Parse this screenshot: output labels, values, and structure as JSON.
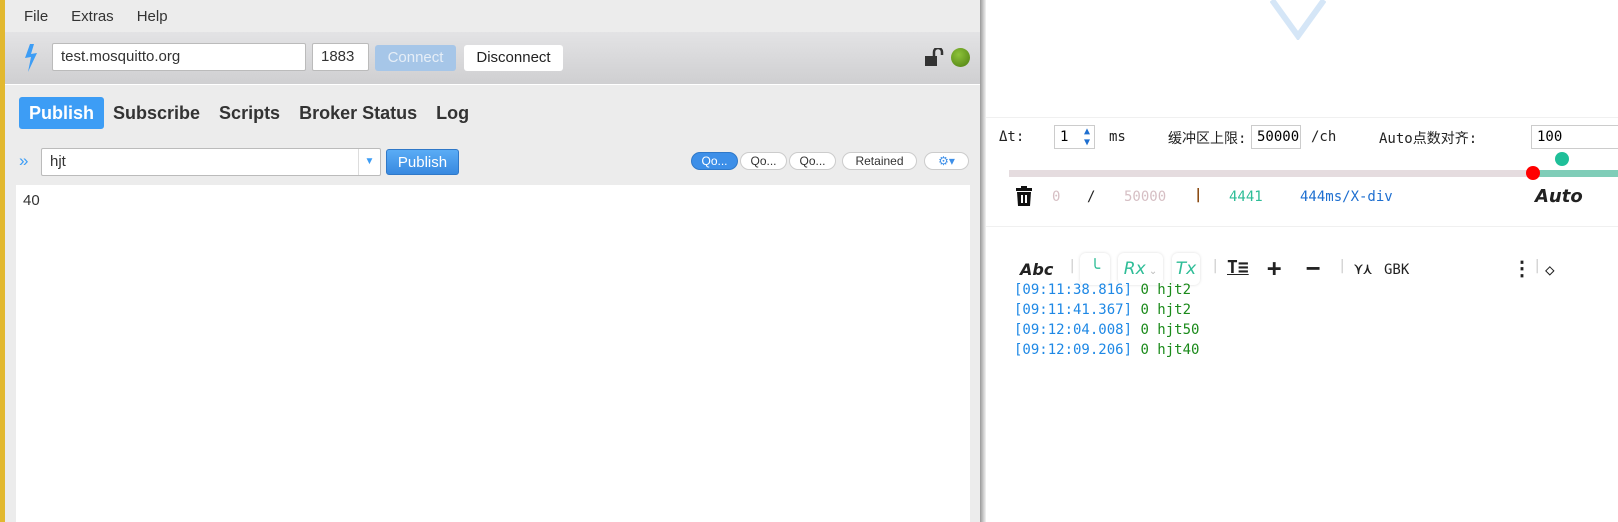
{
  "menu": [
    "File",
    "Extras",
    "Help"
  ],
  "connection": {
    "host": "test.mosquitto.org",
    "port": "1883",
    "connect": "Connect",
    "disconnect": "Disconnect"
  },
  "tabs": [
    "Publish",
    "Subscribe",
    "Scripts",
    "Broker Status",
    "Log"
  ],
  "publish": {
    "topic": "hjt",
    "button": "Publish",
    "qos": [
      "Qo...",
      "Qo...",
      "Qo..."
    ],
    "retained": "Retained",
    "payload": "40"
  },
  "right": {
    "dt_label": "Δt:",
    "dt_value": "1",
    "dt_unit": "ms",
    "buffer_label": "缓冲区上限:",
    "buffer_value": "50000",
    "buffer_unit": "/ch",
    "auto_label": "Auto点数对齐:",
    "auto_value": "100",
    "count": "0",
    "sep": "/",
    "total": "50000",
    "bar": "|",
    "points": "4441",
    "xdiv": "444ms/X-div",
    "auto_text": "Auto",
    "toolbar": {
      "abc": "Abc",
      "rx": "Rx",
      "tx": "Tx",
      "encoding": "GBK"
    },
    "log": [
      {
        "time": "[09:11:38.816]",
        "msg": "0 hjt2"
      },
      {
        "time": "[09:11:41.367]",
        "msg": "0 hjt2"
      },
      {
        "time": "[09:12:04.008]",
        "msg": "0 hjt50"
      },
      {
        "time": "[09:12:09.206]",
        "msg": "0 hjt40"
      }
    ]
  },
  "colors": {
    "accent": "#3d9df5",
    "status_connected": "#6a9e1a",
    "teal": "#2ebd97"
  }
}
